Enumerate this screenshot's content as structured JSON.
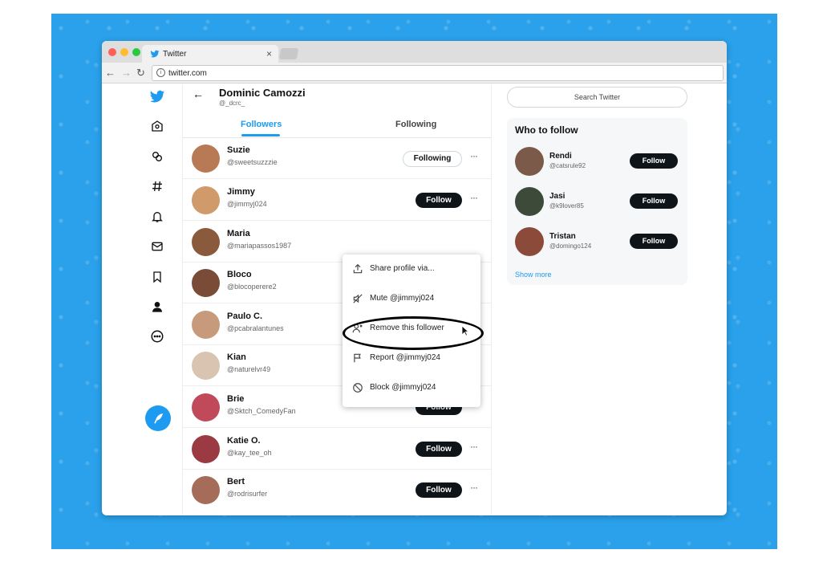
{
  "browser": {
    "tab_title": "Twitter",
    "tab_close": "×",
    "url": "twitter.com",
    "info_glyph": "i",
    "nav": {
      "back": "←",
      "forward": "→",
      "reload": "↻"
    }
  },
  "profile": {
    "back_arrow": "←",
    "name": "Dominic Camozzi",
    "handle": "@_dcrc_",
    "tabs": [
      {
        "label": "Followers",
        "active": true
      },
      {
        "label": "Following",
        "active": false
      }
    ]
  },
  "followers": [
    {
      "name": "Suzie",
      "handle": "@sweetsuzzzie",
      "button": "Following",
      "color": "#b77a55"
    },
    {
      "name": "Jimmy",
      "handle": "@jimmyj024",
      "button": "Follow",
      "color": "#d19a6a"
    },
    {
      "name": "Maria",
      "handle": "@mariapassos1987",
      "button": "",
      "color": "#8a5a3c"
    },
    {
      "name": "Bloco",
      "handle": "@blocoperere2",
      "button": "",
      "color": "#7a4b36"
    },
    {
      "name": "Paulo C.",
      "handle": "@pcabralantunes",
      "button": "",
      "color": "#c69a7a"
    },
    {
      "name": "Kian",
      "handle": "@naturelvr49",
      "button": "",
      "color": "#d8c4b0"
    },
    {
      "name": "Brie",
      "handle": "@Sktch_ComedyFan",
      "button": "Follow",
      "color": "#c0495a"
    },
    {
      "name": "Katie O.",
      "handle": "@kay_tee_oh",
      "button": "Follow",
      "color": "#9c3a44"
    },
    {
      "name": "Bert",
      "handle": "@rodrisurfer",
      "button": "Follow",
      "color": "#a56c5a"
    }
  ],
  "more_glyph": "···",
  "menu": {
    "items": [
      {
        "label": "Share profile via...",
        "icon": "share-icon"
      },
      {
        "label": "Mute @jimmyj024",
        "icon": "mute-icon"
      },
      {
        "label": "Remove this follower",
        "icon": "remove-follower-icon"
      },
      {
        "label": "Report @jimmyj024",
        "icon": "flag-icon"
      },
      {
        "label": "Block @jimmyj024",
        "icon": "block-icon"
      }
    ]
  },
  "search": {
    "placeholder": "Search Twitter"
  },
  "who_to_follow": {
    "title": "Who to follow",
    "users": [
      {
        "name": "Rendi",
        "handle": "@catsrule92",
        "button": "Follow",
        "color": "#7b5a4a"
      },
      {
        "name": "Jasi",
        "handle": "@k9lover85",
        "button": "Follow",
        "color": "#3d4a3a"
      },
      {
        "name": "Tristan",
        "handle": "@domingo124",
        "button": "Follow",
        "color": "#8c4a3a"
      }
    ],
    "show_more": "Show more"
  },
  "colors": {
    "accent": "#1d9bf0",
    "background": "#2aa1ea",
    "dark_button": "#0f1419"
  }
}
